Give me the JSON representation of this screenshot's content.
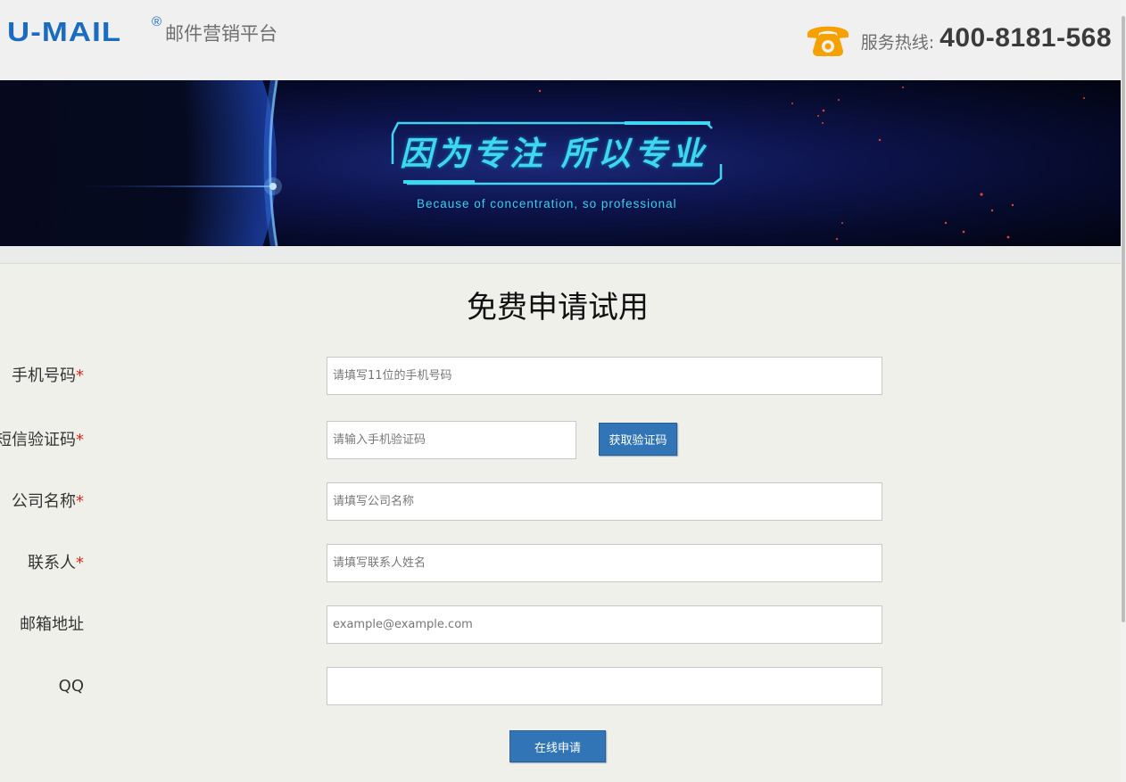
{
  "header": {
    "logo_text": "U-MAIL",
    "logo_reg": "®",
    "logo_subtitle": "邮件营销平台",
    "hotline_label": "服务热线:",
    "hotline_number": "400-8181-568",
    "phone_icon": "phone-icon",
    "accent_color": "#1a6cc0",
    "phone_icon_color": "#f5a200"
  },
  "banner": {
    "title": "因为专注 所以专业",
    "subtitle": "Because of concentration, so professional"
  },
  "form": {
    "title": "免费申请试用",
    "required_mark": "*",
    "fields": [
      {
        "label": "手机号码",
        "required": true,
        "placeholder": "请填写11位的手机号码",
        "value": ""
      },
      {
        "label": "短信验证码",
        "required": true,
        "placeholder": "请输入手机验证码",
        "value": ""
      },
      {
        "label": "公司名称",
        "required": true,
        "placeholder": "请填写公司名称",
        "value": ""
      },
      {
        "label": "联系人",
        "required": true,
        "placeholder": "请填写联系人姓名",
        "value": ""
      },
      {
        "label": "邮箱地址",
        "required": false,
        "placeholder": "example@example.com",
        "value": ""
      },
      {
        "label": "QQ",
        "required": false,
        "placeholder": "",
        "value": ""
      }
    ],
    "get_code_button": "获取验证码",
    "submit_button": "在线申请",
    "button_color": "#3275b7",
    "required_color": "#d9291c"
  }
}
